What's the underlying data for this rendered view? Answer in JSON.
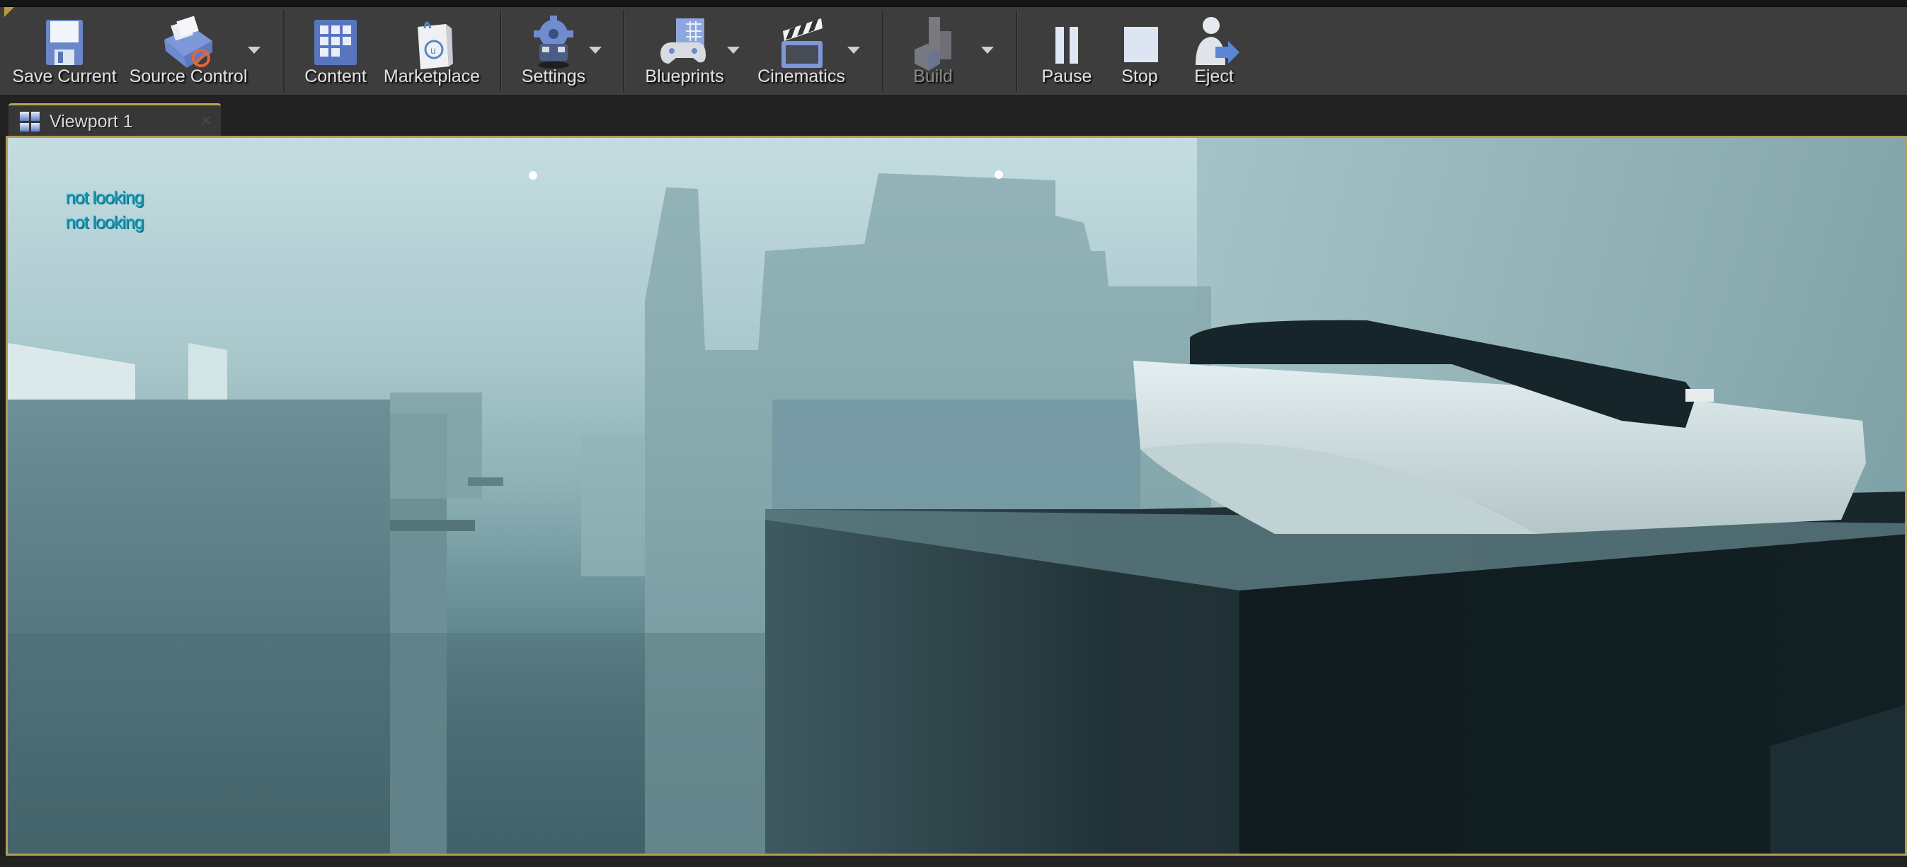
{
  "colors": {
    "toolbar_bg": "#3d3d3d",
    "tab_accent": "#b8a55a",
    "viewport_border": "#b39c56",
    "hud_text": "#1a8ba6"
  },
  "toolbar": {
    "buttons": [
      {
        "id": "save-current",
        "label": "Save Current",
        "icon": "floppy-disk-icon",
        "has_dropdown": false,
        "enabled": true
      },
      {
        "id": "source-control",
        "label": "Source Control",
        "icon": "source-control-icon",
        "has_dropdown": true,
        "enabled": true
      },
      {
        "id": "content",
        "label": "Content",
        "icon": "content-browser-icon",
        "has_dropdown": false,
        "enabled": true
      },
      {
        "id": "marketplace",
        "label": "Marketplace",
        "icon": "shopping-bag-icon",
        "has_dropdown": false,
        "enabled": true
      },
      {
        "id": "settings",
        "label": "Settings",
        "icon": "gear-icon",
        "has_dropdown": true,
        "enabled": true
      },
      {
        "id": "blueprints",
        "label": "Blueprints",
        "icon": "gamepad-icon",
        "has_dropdown": true,
        "enabled": true
      },
      {
        "id": "cinematics",
        "label": "Cinematics",
        "icon": "clapperboard-icon",
        "has_dropdown": true,
        "enabled": true
      },
      {
        "id": "build",
        "label": "Build",
        "icon": "build-blocks-icon",
        "has_dropdown": true,
        "enabled": false
      },
      {
        "id": "pause",
        "label": "Pause",
        "icon": "pause-icon",
        "has_dropdown": false,
        "enabled": true
      },
      {
        "id": "stop",
        "label": "Stop",
        "icon": "stop-icon",
        "has_dropdown": false,
        "enabled": true
      },
      {
        "id": "eject",
        "label": "Eject",
        "icon": "eject-user-icon",
        "has_dropdown": false,
        "enabled": true
      }
    ]
  },
  "tabs": [
    {
      "label": "Viewport 1",
      "icon": "viewport-grid-icon",
      "close_glyph": "×",
      "active": true
    }
  ],
  "viewport": {
    "hud_lines": [
      "not looking",
      "not looking"
    ],
    "scene": "foggy city rooftop with telephone on dark pedestal"
  }
}
